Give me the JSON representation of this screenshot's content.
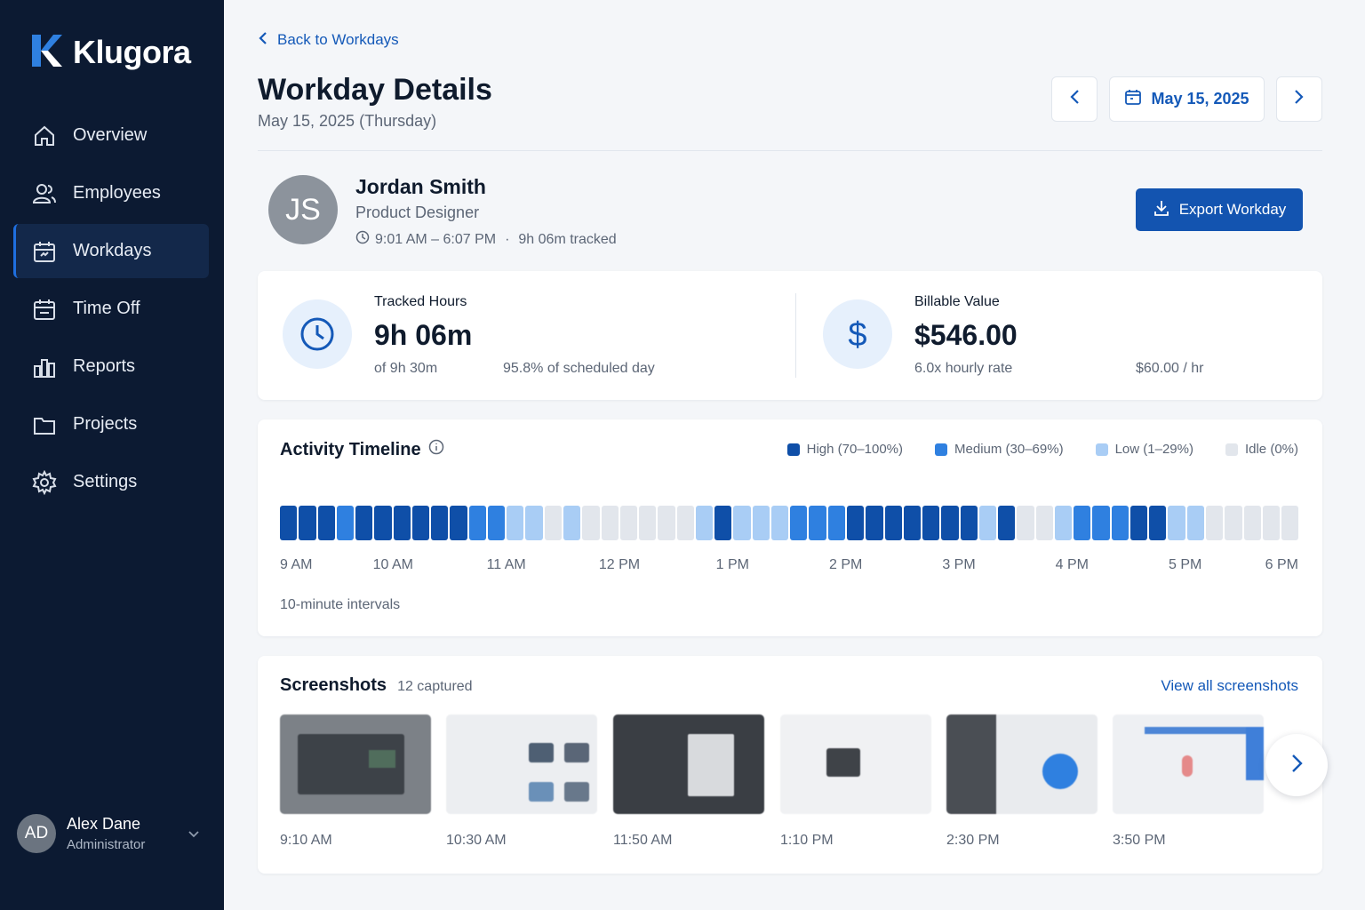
{
  "app": {
    "brand": "Klugora"
  },
  "sidebar": {
    "items": [
      {
        "label": "Overview",
        "icon": "home-icon"
      },
      {
        "label": "Employees",
        "icon": "users-icon"
      },
      {
        "label": "Workdays",
        "icon": "calendar-icon",
        "active": true
      },
      {
        "label": "Time Off",
        "icon": "calendar-icon"
      },
      {
        "label": "Reports",
        "icon": "bar-chart-icon"
      },
      {
        "label": "Projects",
        "icon": "folder-icon"
      },
      {
        "label": "Settings",
        "icon": "gear-icon"
      }
    ],
    "user": {
      "initials": "AD",
      "name": "Alex Dane",
      "role": "Administrator"
    }
  },
  "header": {
    "back_label": "Back to Workdays",
    "title": "Workday Details",
    "subtitle": "May 15, 2025 (Thursday)",
    "date": "May 15, 2025"
  },
  "employee": {
    "initials": "JS",
    "name": "Jordan Smith",
    "role": "Product Designer",
    "time_range": "9:01 AM – 6:07 PM",
    "separator": "·",
    "tracked": "9h 06m tracked",
    "export_label": "Export Workday"
  },
  "stats": {
    "tracked": {
      "label": "Tracked Hours",
      "value": "9h 06m",
      "sub1": "of 9h 30m",
      "sub2": "95.8% of scheduled day"
    },
    "billable": {
      "label": "Billable Value",
      "value": "$546.00",
      "sub1": "6.0x hourly rate",
      "sub2": "$60.00 / hr"
    }
  },
  "timeline": {
    "title": "Activity Timeline",
    "legend": [
      {
        "label": "High (70–100%)",
        "color": "#0f4fa8"
      },
      {
        "label": "Medium (30–69%)",
        "color": "#2f80e0"
      },
      {
        "label": "Low (1–29%)",
        "color": "#a9cdf5"
      },
      {
        "label": "Idle (0%)",
        "color": "#e2e6ec"
      }
    ],
    "levels": [
      "high",
      "high",
      "high",
      "medium",
      "high",
      "high",
      "high",
      "high",
      "high",
      "high",
      "medium",
      "medium",
      "low",
      "low",
      "idle",
      "low",
      "idle",
      "idle",
      "idle",
      "idle",
      "idle",
      "idle",
      "low",
      "high",
      "low",
      "low",
      "low",
      "medium",
      "medium",
      "medium",
      "high",
      "high",
      "high",
      "high",
      "high",
      "high",
      "high",
      "low",
      "high",
      "idle",
      "idle",
      "low",
      "medium",
      "medium",
      "medium",
      "high",
      "high",
      "low",
      "low",
      "idle",
      "idle",
      "idle",
      "idle",
      "idle"
    ],
    "hours": [
      "9 AM",
      "10 AM",
      "11 AM",
      "12 PM",
      "1 PM",
      "2 PM",
      "3 PM",
      "4 PM",
      "5 PM",
      "6 PM"
    ],
    "interval_label": "10-minute intervals"
  },
  "screenshots": {
    "title": "Screenshots",
    "count_label": "12 captured",
    "view_all": "View all screenshots",
    "items": [
      {
        "time": "9:10 AM",
        "theme": "dark"
      },
      {
        "time": "10:30 AM",
        "theme": "light"
      },
      {
        "time": "11:50 AM",
        "theme": "dark"
      },
      {
        "time": "1:10 PM",
        "theme": "light"
      },
      {
        "time": "2:30 PM",
        "theme": "mixed"
      },
      {
        "time": "3:50 PM",
        "theme": "light-blue"
      }
    ]
  }
}
